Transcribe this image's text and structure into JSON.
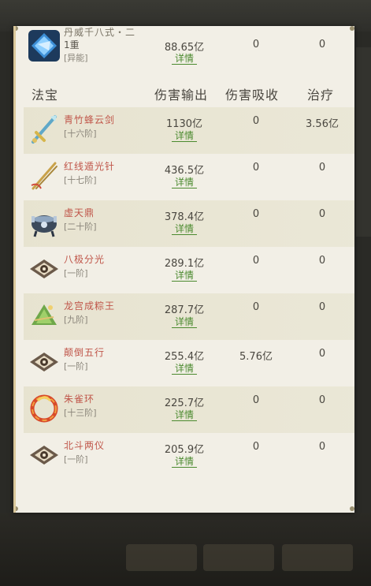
{
  "top_entry": {
    "name": "丹威千八式・二",
    "level": "1重",
    "tag": "[异能]",
    "damage": "88.65亿",
    "detail": "详情",
    "absorb": "0",
    "heal": "0"
  },
  "headers": {
    "treasure": "法宝",
    "damage": "伤害输出",
    "absorb": "伤害吸收",
    "heal": "治疗"
  },
  "rows": [
    {
      "name": "青竹蜂云剑",
      "tier": "[十六阶]",
      "damage": "1130亿",
      "detail": "详情",
      "absorb": "0",
      "heal": "3.56亿",
      "icon": "sword-icon"
    },
    {
      "name": "红线遁光针",
      "tier": "[十七阶]",
      "damage": "436.5亿",
      "detail": "详情",
      "absorb": "0",
      "heal": "0",
      "icon": "needle-icon"
    },
    {
      "name": "虚天鼎",
      "tier": "[二十阶]",
      "damage": "378.4亿",
      "detail": "详情",
      "absorb": "0",
      "heal": "0",
      "icon": "cauldron-icon"
    },
    {
      "name": "八极分光",
      "tier": "[一阶]",
      "damage": "289.1亿",
      "detail": "详情",
      "absorb": "0",
      "heal": "0",
      "icon": "eye-talisman-icon"
    },
    {
      "name": "龙宫成粽王",
      "tier": "[九阶]",
      "damage": "287.7亿",
      "detail": "详情",
      "absorb": "0",
      "heal": "0",
      "icon": "zongzi-icon"
    },
    {
      "name": "颠倒五行",
      "tier": "[一阶]",
      "damage": "255.4亿",
      "detail": "详情",
      "absorb": "5.76亿",
      "heal": "0",
      "icon": "eye-talisman-icon"
    },
    {
      "name": "朱雀环",
      "tier": "[十三阶]",
      "damage": "225.7亿",
      "detail": "详情",
      "absorb": "0",
      "heal": "0",
      "icon": "vermilion-bird-ring-icon"
    },
    {
      "name": "北斗两仪",
      "tier": "[一阶]",
      "damage": "205.9亿",
      "detail": "详情",
      "absorb": "0",
      "heal": "0",
      "icon": "eye-talisman-icon"
    }
  ]
}
